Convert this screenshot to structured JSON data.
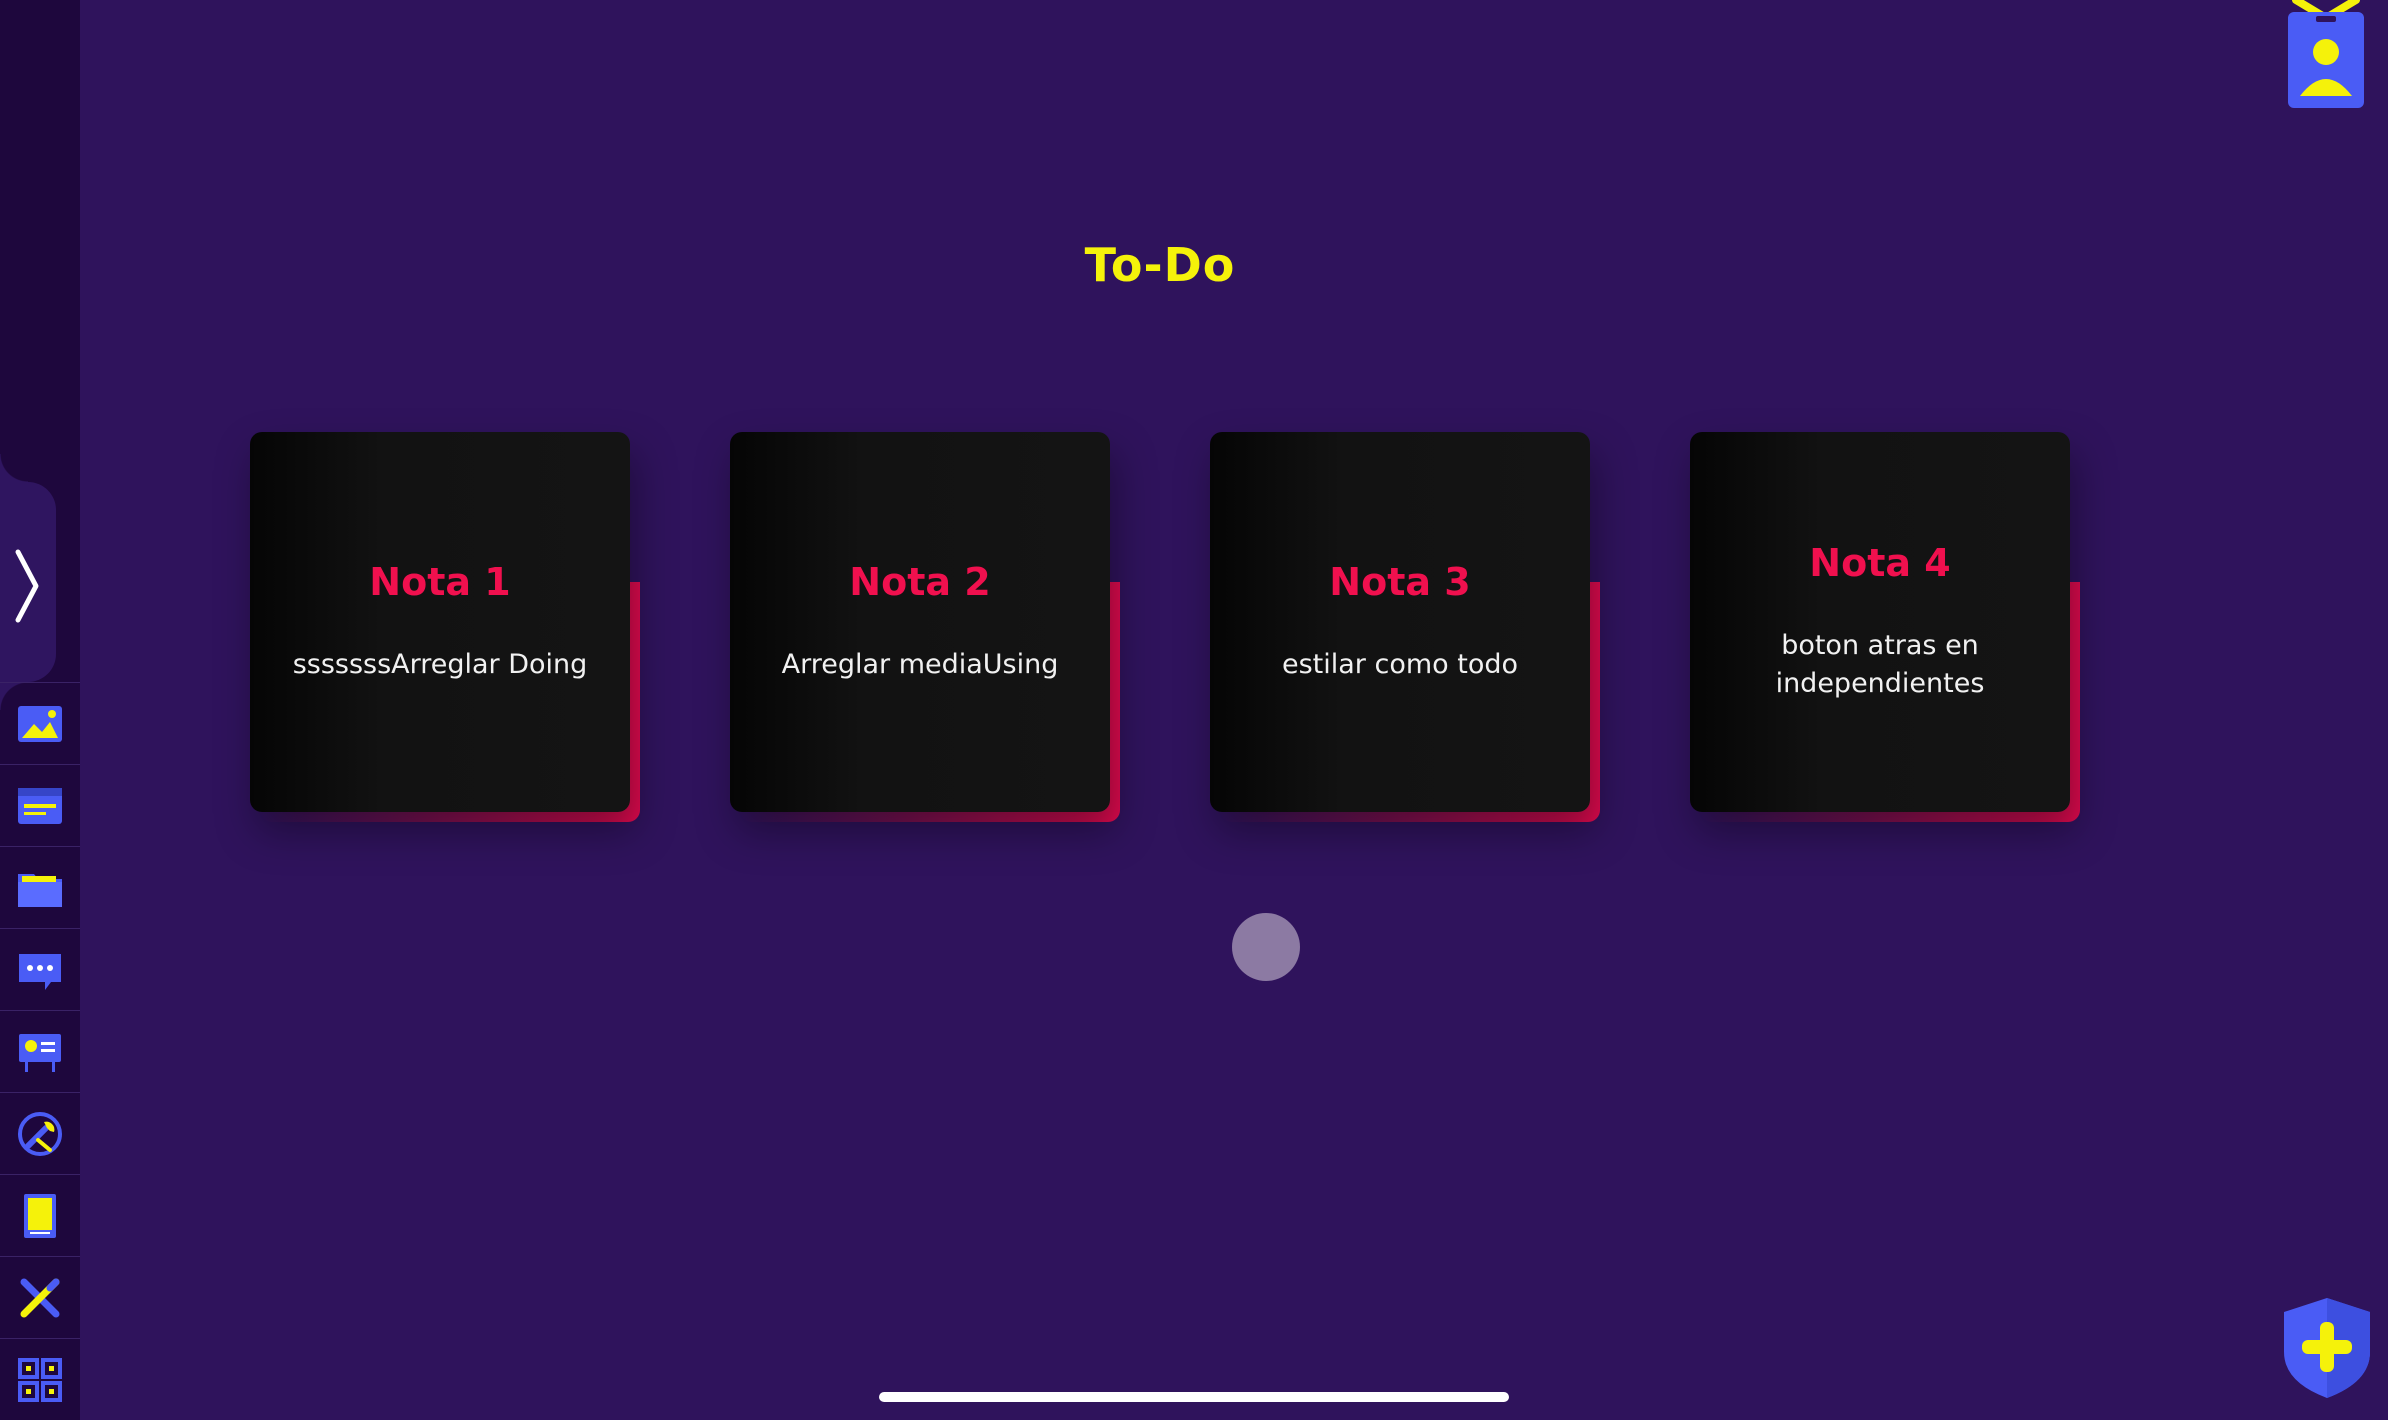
{
  "page": {
    "title": "To-Do"
  },
  "sidebar": {
    "toggle_icon": "chevron-right-icon",
    "items": [
      {
        "icon": "image-gallery-icon"
      },
      {
        "icon": "browser-window-icon"
      },
      {
        "icon": "folder-icon"
      },
      {
        "icon": "chat-bubble-icon"
      },
      {
        "icon": "id-card-icon"
      },
      {
        "icon": "wrench-tools-icon"
      },
      {
        "icon": "notepad-icon"
      },
      {
        "icon": "pencil-ruler-icon"
      },
      {
        "icon": "qr-code-icon"
      }
    ]
  },
  "notes": [
    {
      "title": "Nota 1",
      "body": "sssssssArreglar Doing"
    },
    {
      "title": "Nota 2",
      "body": "Arreglar mediaUsing"
    },
    {
      "title": "Nota 3",
      "body": "estilar como todo"
    },
    {
      "title": "Nota 4",
      "body": "boton atras en independientes"
    }
  ],
  "colors": {
    "background": "#2f135c",
    "title": "#f5f20a",
    "note_title": "#f0104e",
    "card": "#121212",
    "icon_blue": "#4a5cf5",
    "icon_yellow": "#f5f20a"
  },
  "actions": {
    "profile_icon": "profile-badge-icon",
    "add_icon": "add-shield-icon"
  }
}
